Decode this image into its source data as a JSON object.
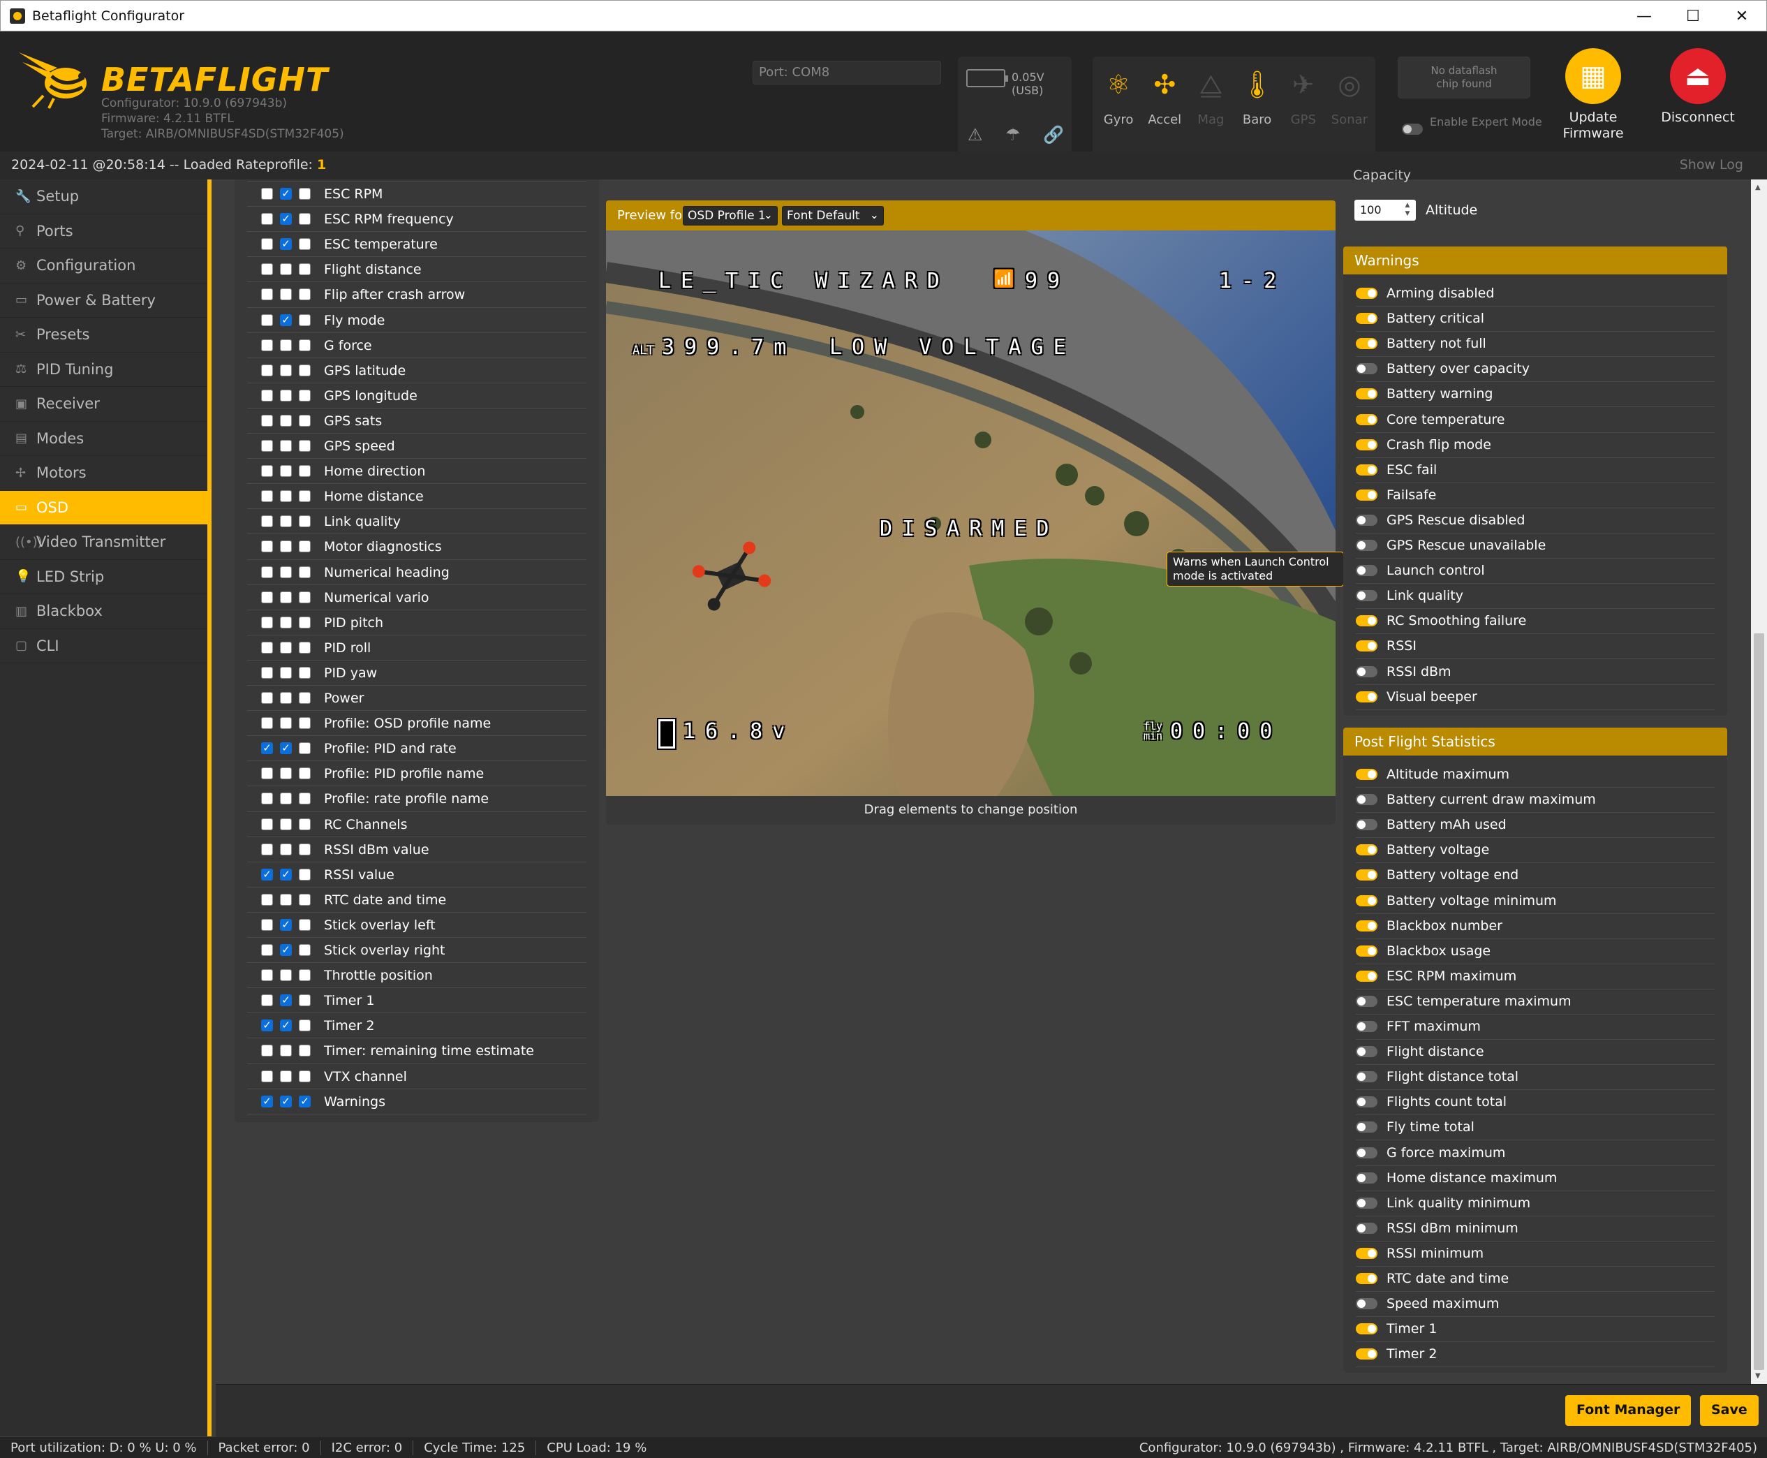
{
  "window": {
    "title": "Betaflight Configurator",
    "min": "—",
    "max": "☐",
    "close": "✕"
  },
  "header": {
    "brand": "BETAFLIGHT",
    "configurator": "Configurator: 10.9.0 (697943b)",
    "firmware": "Firmware: 4.2.11 BTFL",
    "target": "Target: AIRB/OMNIBUSF4SD(STM32F405)",
    "port_label": "Port:",
    "port_value": "COM8",
    "battery": "0.05V (USB)",
    "sensors": [
      {
        "label": "Gyro",
        "icon": "gyro-icon",
        "active": true
      },
      {
        "label": "Accel",
        "icon": "accel-icon",
        "active": true
      },
      {
        "label": "Mag",
        "icon": "mag-icon",
        "active": false
      },
      {
        "label": "Baro",
        "icon": "baro-icon",
        "active": true
      },
      {
        "label": "GPS",
        "icon": "gps-icon",
        "active": false
      },
      {
        "label": "Sonar",
        "icon": "sonar-icon",
        "active": false
      }
    ],
    "dataflash_line1": "No dataflash",
    "dataflash_line2": "chip found",
    "expert_mode": "Enable Expert Mode",
    "update_line1": "Update",
    "update_line2": "Firmware",
    "disconnect": "Disconnect"
  },
  "logbar": {
    "text": "2024-02-11 @20:58:14 -- Loaded Rateprofile:",
    "profile": "1",
    "show_log": "Show Log"
  },
  "sidebar": {
    "items": [
      {
        "label": "Setup",
        "icon": "wrench-icon"
      },
      {
        "label": "Ports",
        "icon": "plug-icon"
      },
      {
        "label": "Configuration",
        "icon": "gear-icon"
      },
      {
        "label": "Power & Battery",
        "icon": "battery-icon"
      },
      {
        "label": "Presets",
        "icon": "presets-icon"
      },
      {
        "label": "PID Tuning",
        "icon": "pid-icon"
      },
      {
        "label": "Receiver",
        "icon": "receiver-icon"
      },
      {
        "label": "Modes",
        "icon": "modes-icon"
      },
      {
        "label": "Motors",
        "icon": "motor-icon"
      },
      {
        "label": "OSD",
        "icon": "osd-icon",
        "active": true
      },
      {
        "label": "Video Transmitter",
        "icon": "vtx-icon"
      },
      {
        "label": "LED Strip",
        "icon": "led-icon"
      },
      {
        "label": "Blackbox",
        "icon": "blackbox-icon"
      },
      {
        "label": "CLI",
        "icon": "cli-icon"
      }
    ]
  },
  "elements": [
    {
      "label": "ESC RPM",
      "p": [
        false,
        true,
        false
      ]
    },
    {
      "label": "ESC RPM frequency",
      "p": [
        false,
        true,
        false
      ]
    },
    {
      "label": "ESC temperature",
      "p": [
        false,
        true,
        false
      ]
    },
    {
      "label": "Flight distance",
      "p": [
        false,
        false,
        false
      ]
    },
    {
      "label": "Flip after crash arrow",
      "p": [
        false,
        false,
        false
      ]
    },
    {
      "label": "Fly mode",
      "p": [
        false,
        true,
        false
      ]
    },
    {
      "label": "G force",
      "p": [
        false,
        false,
        false
      ]
    },
    {
      "label": "GPS latitude",
      "p": [
        false,
        false,
        false
      ]
    },
    {
      "label": "GPS longitude",
      "p": [
        false,
        false,
        false
      ]
    },
    {
      "label": "GPS sats",
      "p": [
        false,
        false,
        false
      ]
    },
    {
      "label": "GPS speed",
      "p": [
        false,
        false,
        false
      ]
    },
    {
      "label": "Home direction",
      "p": [
        false,
        false,
        false
      ]
    },
    {
      "label": "Home distance",
      "p": [
        false,
        false,
        false
      ]
    },
    {
      "label": "Link quality",
      "p": [
        false,
        false,
        false
      ]
    },
    {
      "label": "Motor diagnostics",
      "p": [
        false,
        false,
        false
      ]
    },
    {
      "label": "Numerical heading",
      "p": [
        false,
        false,
        false
      ]
    },
    {
      "label": "Numerical vario",
      "p": [
        false,
        false,
        false
      ]
    },
    {
      "label": "PID pitch",
      "p": [
        false,
        false,
        false
      ]
    },
    {
      "label": "PID roll",
      "p": [
        false,
        false,
        false
      ]
    },
    {
      "label": "PID yaw",
      "p": [
        false,
        false,
        false
      ]
    },
    {
      "label": "Power",
      "p": [
        false,
        false,
        false
      ]
    },
    {
      "label": "Profile: OSD profile name",
      "p": [
        false,
        false,
        false
      ]
    },
    {
      "label": "Profile: PID and rate",
      "p": [
        true,
        true,
        false
      ]
    },
    {
      "label": "Profile: PID profile name",
      "p": [
        false,
        false,
        false
      ]
    },
    {
      "label": "Profile: rate profile name",
      "p": [
        false,
        false,
        false
      ]
    },
    {
      "label": "RC Channels",
      "p": [
        false,
        false,
        false
      ]
    },
    {
      "label": "RSSI dBm value",
      "p": [
        false,
        false,
        false
      ]
    },
    {
      "label": "RSSI value",
      "p": [
        true,
        true,
        false
      ]
    },
    {
      "label": "RTC date and time",
      "p": [
        false,
        false,
        false
      ]
    },
    {
      "label": "Stick overlay left",
      "p": [
        false,
        true,
        false
      ]
    },
    {
      "label": "Stick overlay right",
      "p": [
        false,
        true,
        false
      ]
    },
    {
      "label": "Throttle position",
      "p": [
        false,
        false,
        false
      ]
    },
    {
      "label": "Timer 1",
      "p": [
        false,
        true,
        false
      ]
    },
    {
      "label": "Timer 2",
      "p": [
        true,
        true,
        false
      ]
    },
    {
      "label": "Timer: remaining time estimate",
      "p": [
        false,
        false,
        false
      ]
    },
    {
      "label": "VTX channel",
      "p": [
        false,
        false,
        false
      ]
    },
    {
      "label": "Warnings",
      "p": [
        true,
        true,
        true
      ]
    }
  ],
  "preview": {
    "label": "Preview for",
    "profile": "OSD Profile 1",
    "font": "Font Default",
    "osd_name": "LE_TIC WIZARD",
    "osd_rssi": "99",
    "osd_profile": "1-2",
    "osd_alt_prefix": "ALT",
    "osd_alt": "399.7m",
    "osd_warning": "LOW VOLTAGE",
    "osd_disarmed": "DISARMED",
    "osd_voltage": "16.8v",
    "osd_timer_prefix": "fly min",
    "osd_timer": "00:00",
    "hint": "Drag elements to change position"
  },
  "tooltip": "Warns when Launch Control mode is activated",
  "alarms": {
    "altitude_value": "100",
    "altitude_label": "Altitude",
    "capacity_label": "Capacity"
  },
  "warnings": {
    "title": "Warnings",
    "items": [
      {
        "label": "Arming disabled",
        "on": true
      },
      {
        "label": "Battery critical",
        "on": true
      },
      {
        "label": "Battery not full",
        "on": true
      },
      {
        "label": "Battery over capacity",
        "on": false
      },
      {
        "label": "Battery warning",
        "on": true
      },
      {
        "label": "Core temperature",
        "on": true
      },
      {
        "label": "Crash flip mode",
        "on": true
      },
      {
        "label": "ESC fail",
        "on": true
      },
      {
        "label": "Failsafe",
        "on": true
      },
      {
        "label": "GPS Rescue disabled",
        "on": false
      },
      {
        "label": "GPS Rescue unavailable",
        "on": false
      },
      {
        "label": "Launch control",
        "on": false
      },
      {
        "label": "Link quality",
        "on": false
      },
      {
        "label": "RC Smoothing failure",
        "on": true
      },
      {
        "label": "RSSI",
        "on": true
      },
      {
        "label": "RSSI dBm",
        "on": false
      },
      {
        "label": "Visual beeper",
        "on": true
      }
    ]
  },
  "stats": {
    "title": "Post Flight Statistics",
    "items": [
      {
        "label": "Altitude maximum",
        "on": true
      },
      {
        "label": "Battery current draw maximum",
        "on": false
      },
      {
        "label": "Battery mAh used",
        "on": false
      },
      {
        "label": "Battery voltage",
        "on": true
      },
      {
        "label": "Battery voltage end",
        "on": true
      },
      {
        "label": "Battery voltage minimum",
        "on": true
      },
      {
        "label": "Blackbox number",
        "on": true
      },
      {
        "label": "Blackbox usage",
        "on": true
      },
      {
        "label": "ESC RPM maximum",
        "on": true
      },
      {
        "label": "ESC temperature maximum",
        "on": false
      },
      {
        "label": "FFT maximum",
        "on": false
      },
      {
        "label": "Flight distance",
        "on": false
      },
      {
        "label": "Flight distance total",
        "on": false
      },
      {
        "label": "Flights count total",
        "on": false
      },
      {
        "label": "Fly time total",
        "on": false
      },
      {
        "label": "G force maximum",
        "on": false
      },
      {
        "label": "Home distance maximum",
        "on": false
      },
      {
        "label": "Link quality minimum",
        "on": false
      },
      {
        "label": "RSSI dBm minimum",
        "on": false
      },
      {
        "label": "RSSI minimum",
        "on": true
      },
      {
        "label": "RTC date and time",
        "on": true
      },
      {
        "label": "Speed maximum",
        "on": false
      },
      {
        "label": "Timer 1",
        "on": true
      },
      {
        "label": "Timer 2",
        "on": true
      }
    ]
  },
  "buttons": {
    "font_manager": "Font Manager",
    "save": "Save"
  },
  "statusbar": {
    "port_util": "Port utilization: D: 0 % U: 0 %",
    "packet_error": "Packet error: 0",
    "i2c_error": "I2C error: 0",
    "cycle_time": "Cycle Time: 125",
    "cpu_load": "CPU Load: 19 %",
    "version": "Configurator: 10.9.0 (697943b) , Firmware: 4.2.11 BTFL , Target: AIRB/OMNIBUSF4SD(STM32F405)"
  },
  "colors": {
    "accent": "#ffbb00",
    "section_header": "#ba8a00",
    "checkbox_on": "#0a6fdc",
    "disconnect": "#e2212b"
  }
}
